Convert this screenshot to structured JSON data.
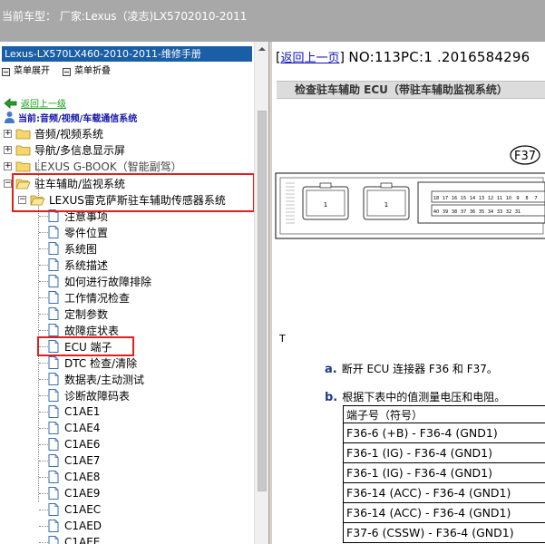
{
  "window": {
    "title": "当前车型：  厂家:Lexus（凌志)LX5702010-2011"
  },
  "left_panel": {
    "manual_title": "Lexus-LX570LX460-2010-2011-维修手册",
    "menu": {
      "expand": "菜单展开",
      "collapse": "菜单折叠"
    },
    "back_link": "返回上一级",
    "current_path": "当前:音频/视频/车载通信系统",
    "tree": {
      "top_folders": [
        "音频/视频系统",
        "导航/多信息显示屏",
        "LEXUS G-BOOK（智能副驾）",
        "驻车辅助/监视系统"
      ],
      "subfolder": "LEXUS雷克萨斯驻车辅助传感器系统",
      "pages": [
        "注意事项",
        "零件位置",
        "系统图",
        "系统描述",
        "如何进行故障排除",
        "工作情况检查",
        "定制参数",
        "故障症状表",
        "ECU 端子",
        "DTC 检查/清除",
        "数据表/主动测试",
        "诊断故障码表",
        "C1AE1",
        "C1AE4",
        "C1AE6",
        "C1AE7",
        "C1AE8",
        "C1AE9",
        "C1AEC",
        "C1AED",
        "C1AEE"
      ]
    }
  },
  "right_panel": {
    "back_link": "返回上一页",
    "doc_id": "NO:113PC:1 .2016584296",
    "header": "检查驻车辅助 ECU（带驻车辅助监视系统）",
    "connector_label": "F37",
    "connector_pin_a": "1",
    "connector_pin_b": "1",
    "t_label": "T",
    "step_a_letter": "a.",
    "step_a_text": "断开 ECU 连接器 F36 和 F37。",
    "step_b_letter": "b.",
    "step_b_text": "根据下表中的值测量电压和电阻。",
    "table_header": "端子号（符号）",
    "table_rows": [
      "F36-6 (+B) - F36-4 (GND1)",
      "F36-1 (IG) - F36-4 (GND1)",
      "F36-1 (IG) - F36-4 (GND1)",
      "F36-14 (ACC) - F36-4 (GND1)",
      "F36-14 (ACC) - F36-4 (GND1)",
      "F37-6 (CSSW) - F36-4 (GND1)"
    ],
    "pin_numbers_top": [
      "18",
      "17",
      "16",
      "15",
      "14",
      "13",
      "12",
      "11",
      "10",
      "9",
      "8",
      "7"
    ],
    "pin_numbers_bottom": [
      "40",
      "39",
      "38",
      "37",
      "36",
      "35",
      "34",
      "33",
      "32",
      "31"
    ]
  },
  "colors": {
    "title_bar": "#a8a8a8",
    "manual_title_bg": "#1a5ea8",
    "highlight_box": "#e02020",
    "link": "#1010c0",
    "back_link_green": "#15a015"
  }
}
